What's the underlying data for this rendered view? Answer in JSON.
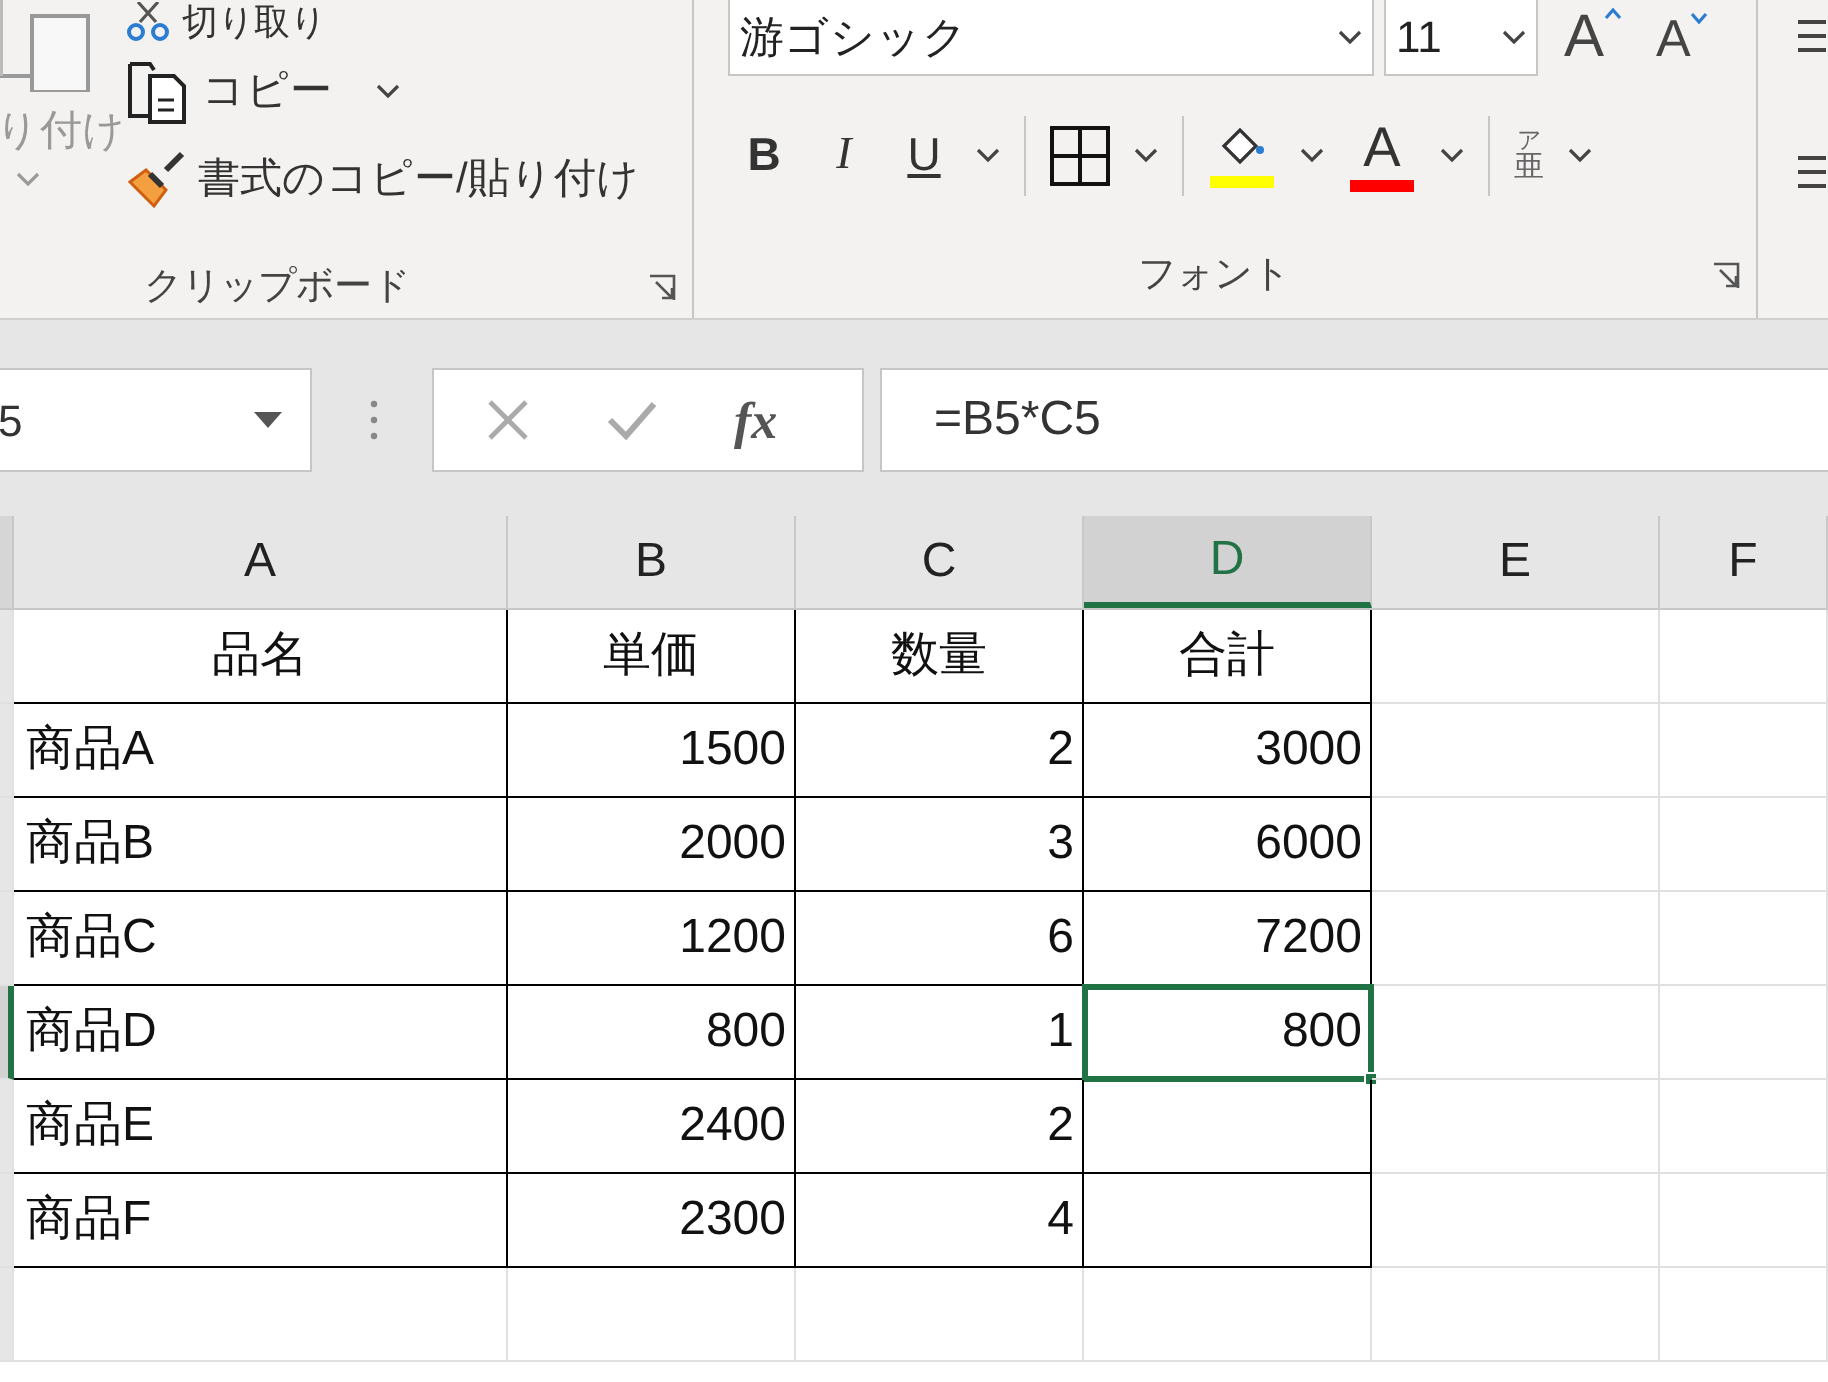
{
  "ribbon": {
    "clipboard": {
      "paste_label": "り付け",
      "cut": "切り取り",
      "copy": "コピー",
      "format_painter": "書式のコピー/貼り付け",
      "group_label": "クリップボード"
    },
    "font": {
      "font_name": "游ゴシック",
      "font_size": "11",
      "grow_font": "A",
      "shrink_font": "A",
      "bold": "B",
      "italic": "I",
      "underline": "U",
      "font_color": "A",
      "phonetic_top": "ア",
      "phonetic_bottom": "亜",
      "group_label": "フォント"
    }
  },
  "formula_bar": {
    "name_box": "5",
    "fx": "fx",
    "formula": "=B5*C5"
  },
  "columns": [
    {
      "label": "A",
      "selected": false
    },
    {
      "label": "B",
      "selected": false
    },
    {
      "label": "C",
      "selected": false
    },
    {
      "label": "D",
      "selected": true
    },
    {
      "label": "E",
      "selected": false
    },
    {
      "label": "F",
      "selected": false
    }
  ],
  "rows": [
    {
      "selected": false,
      "cells": [
        "品名",
        "単価",
        "数量",
        "合計"
      ]
    },
    {
      "selected": false,
      "cells": [
        "商品A",
        "1500",
        "2",
        "3000"
      ]
    },
    {
      "selected": false,
      "cells": [
        "商品B",
        "2000",
        "3",
        "6000"
      ]
    },
    {
      "selected": false,
      "cells": [
        "商品C",
        "1200",
        "6",
        "7200"
      ]
    },
    {
      "selected": true,
      "cells": [
        "商品D",
        "800",
        "1",
        "800"
      ]
    },
    {
      "selected": false,
      "cells": [
        "商品E",
        "2400",
        "2",
        ""
      ]
    },
    {
      "selected": false,
      "cells": [
        "商品F",
        "2300",
        "4",
        ""
      ]
    }
  ]
}
